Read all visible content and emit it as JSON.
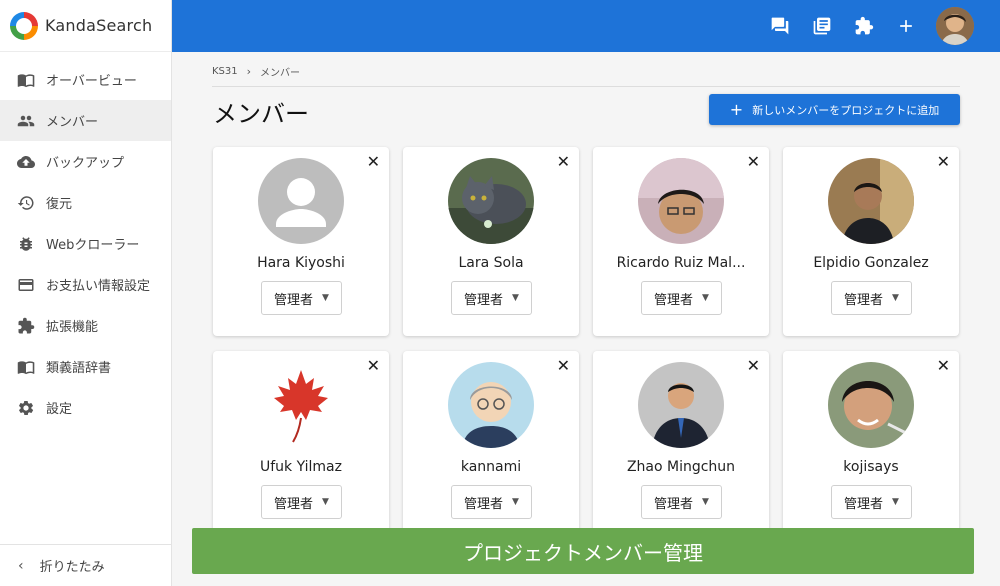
{
  "brand": {
    "name": "KandaSearch"
  },
  "sidebar": {
    "items": [
      {
        "label": "オーバービュー",
        "icon": "book-icon",
        "active": false
      },
      {
        "label": "メンバー",
        "icon": "people-icon",
        "active": true
      },
      {
        "label": "バックアップ",
        "icon": "cloud-upload-icon",
        "active": false
      },
      {
        "label": "復元",
        "icon": "history-icon",
        "active": false
      },
      {
        "label": "Webクローラー",
        "icon": "bug-icon",
        "active": false
      },
      {
        "label": "お支払い情報設定",
        "icon": "credit-card-icon",
        "active": false
      },
      {
        "label": "拡張機能",
        "icon": "puzzle-icon",
        "active": false
      },
      {
        "label": "類義語辞書",
        "icon": "book-icon",
        "active": false
      },
      {
        "label": "設定",
        "icon": "gear-icon",
        "active": false
      }
    ],
    "collapse_label": "折りたたみ"
  },
  "topbar": {
    "icons": [
      "chat-icon",
      "library-icon",
      "puzzle-icon",
      "plus-icon"
    ],
    "avatar": "user-avatar"
  },
  "breadcrumb": {
    "root": "KS31",
    "current": "メンバー"
  },
  "page": {
    "title": "メンバー",
    "add_button": "新しいメンバーをプロジェクトに追加"
  },
  "members": [
    {
      "name": "Hara Kiyoshi",
      "role": "管理者"
    },
    {
      "name": "Lara Sola",
      "role": "管理者"
    },
    {
      "name": "Ricardo Ruiz Mal...",
      "role": "管理者"
    },
    {
      "name": "Elpidio Gonzalez",
      "role": "管理者"
    },
    {
      "name": "Ufuk Yilmaz",
      "role": "管理者"
    },
    {
      "name": "kannami",
      "role": "管理者"
    },
    {
      "name": "Zhao Mingchun",
      "role": "管理者"
    },
    {
      "name": "kojisays",
      "role": "管理者"
    }
  ],
  "banner": {
    "text": "プロジェクトメンバー管理"
  },
  "colors": {
    "primary": "#1e73d8",
    "banner": "#69a84f",
    "sidebar_active": "#eeeeee"
  }
}
